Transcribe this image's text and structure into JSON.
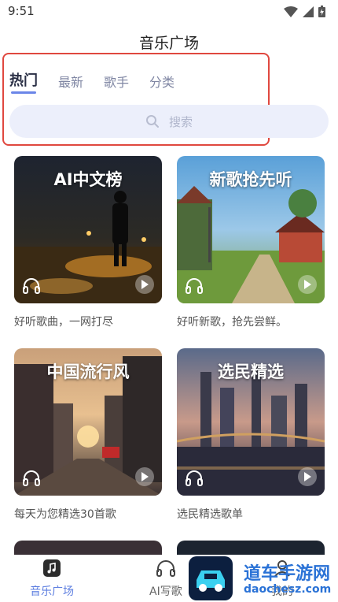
{
  "status": {
    "time": "9:51"
  },
  "header": {
    "title": "音乐广场"
  },
  "tabs": [
    {
      "label": "热门"
    },
    {
      "label": "最新"
    },
    {
      "label": "歌手"
    },
    {
      "label": "分类"
    }
  ],
  "search": {
    "placeholder": "搜索"
  },
  "cards": [
    {
      "title": "AI中文榜",
      "desc": "好听歌曲，一网打尽"
    },
    {
      "title": "新歌抢先听",
      "desc": "好听新歌，抢先尝鲜。"
    },
    {
      "title": "中国流行风",
      "desc": "每天为您精选30首歌"
    },
    {
      "title": "选民精选",
      "desc": "选民精选歌单"
    }
  ],
  "nav": [
    {
      "label": "音乐广场",
      "icon": "music-note-icon"
    },
    {
      "label": "AI写歌",
      "icon": "headphones-icon"
    },
    {
      "label": "我的",
      "icon": "user-icon"
    }
  ],
  "watermark": {
    "title": "道车手游网",
    "url": "daochesz.com"
  },
  "colors": {
    "accent": "#5e7fe0",
    "highlight": "#e0483f",
    "search_bg": "#eceffb"
  }
}
